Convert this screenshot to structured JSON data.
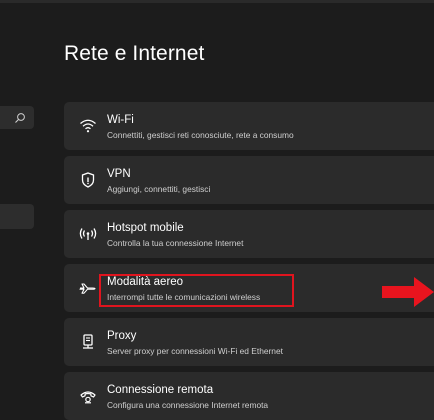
{
  "page": {
    "title": "Rete e Internet"
  },
  "colors": {
    "background": "#1c1c1c",
    "card": "#2b2b2b",
    "highlight": "#e0141e",
    "arrow": "#e8141e"
  },
  "search": {
    "icon": "search-icon"
  },
  "settings": [
    {
      "icon": "wifi-icon",
      "title": "Wi-Fi",
      "description": "Connettiti, gestisci reti conosciute, rete a consumo"
    },
    {
      "icon": "vpn-shield-icon",
      "title": "VPN",
      "description": "Aggiungi, connettiti, gestisci"
    },
    {
      "icon": "hotspot-icon",
      "title": "Hotspot mobile",
      "description": "Controlla la tua connessione Internet"
    },
    {
      "icon": "airplane-icon",
      "title": "Modalità aereo",
      "description": "Interrompi tutte le comunicazioni wireless"
    },
    {
      "icon": "proxy-icon",
      "title": "Proxy",
      "description": "Server proxy per connessioni Wi-Fi ed Ethernet"
    },
    {
      "icon": "dialup-phone-icon",
      "title": "Connessione remota",
      "description": "Configura una connessione Internet remota"
    }
  ]
}
